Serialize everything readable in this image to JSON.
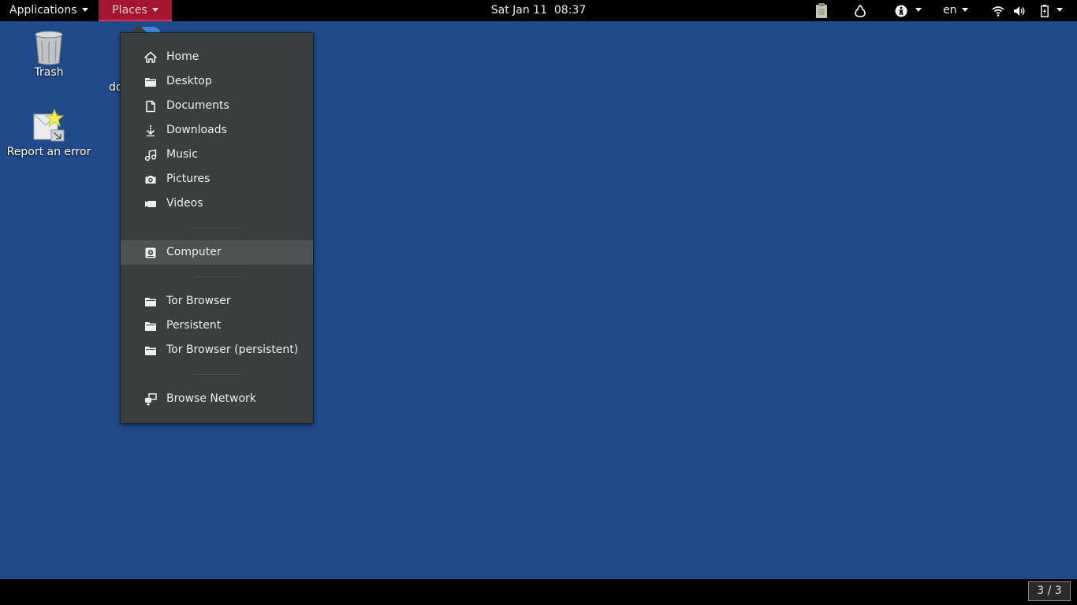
{
  "topbar": {
    "applications_label": "Applications",
    "places_label": "Places",
    "clock": "Sat Jan 11  08:37",
    "language": "en"
  },
  "desktop": {
    "icons": [
      {
        "label": "Trash",
        "icon": "trash-icon"
      },
      {
        "label": "Report an error",
        "icon": "report-error-icon"
      },
      {
        "label": "do",
        "icon": "doc-icon"
      }
    ]
  },
  "places_menu": {
    "items": [
      {
        "label": "Home",
        "icon": "home-icon"
      },
      {
        "label": "Desktop",
        "icon": "folder-icon"
      },
      {
        "label": "Documents",
        "icon": "document-icon"
      },
      {
        "label": "Downloads",
        "icon": "download-icon"
      },
      {
        "label": "Music",
        "icon": "music-icon"
      },
      {
        "label": "Pictures",
        "icon": "camera-icon"
      },
      {
        "label": "Videos",
        "icon": "video-icon"
      },
      {
        "label": "Computer",
        "icon": "drive-icon",
        "highlighted": true
      },
      {
        "label": "Tor Browser",
        "icon": "folder-icon"
      },
      {
        "label": "Persistent",
        "icon": "folder-icon"
      },
      {
        "label": "Tor Browser (persistent)",
        "icon": "folder-icon"
      },
      {
        "label": "Browse Network",
        "icon": "network-icon"
      }
    ]
  },
  "bottombar": {
    "workspace": "3 / 3"
  },
  "colors": {
    "desktop_bg": "#214a8a",
    "panel_bg": "#000000",
    "places_active": "#a31531",
    "menu_bg": "#393f3f"
  }
}
